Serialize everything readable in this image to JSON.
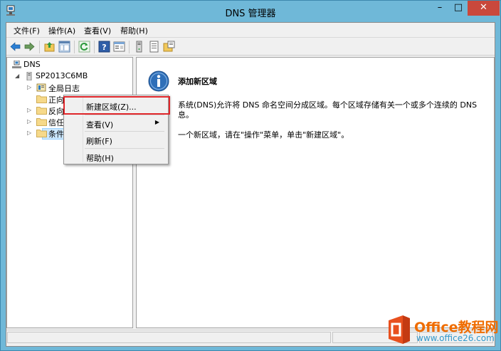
{
  "window": {
    "title": "DNS 管理器"
  },
  "menubar": {
    "items": [
      "文件(F)",
      "操作(A)",
      "查看(V)",
      "帮助(H)"
    ]
  },
  "toolbar": {
    "icons": [
      "back-arrow-icon",
      "forward-arrow-icon",
      "up-folder-icon",
      "show-hide-tree-icon",
      "refresh-icon",
      "help-icon",
      "properties-icon",
      "server-icon",
      "list-icon",
      "zone-icon"
    ]
  },
  "tree": {
    "root": "DNS",
    "server": "SP2013C6MB",
    "children": [
      "全局日志",
      "正向查找区域",
      "反向",
      "信任",
      "条件"
    ]
  },
  "detail": {
    "title": "添加新区域",
    "line1": "系统(DNS)允许将 DNS 命名空间分成区域。每个区域存储有关一个或多个连续的 DNS",
    "line2": "息。",
    "line3": "一个新区域，请在\"操作\"菜单，单击\"新建区域\"。"
  },
  "context_menu": {
    "items": [
      "新建区域(Z)...",
      "查看(V)",
      "刷新(F)",
      "帮助(H)"
    ],
    "highlight_color": "#e0262a"
  },
  "watermark": {
    "text": "Office教程网",
    "sub": "www.office26.com"
  },
  "colors": {
    "titlebar": "#6fb8d8",
    "close_button": "#c9483c",
    "selection": "#cce8ff"
  }
}
